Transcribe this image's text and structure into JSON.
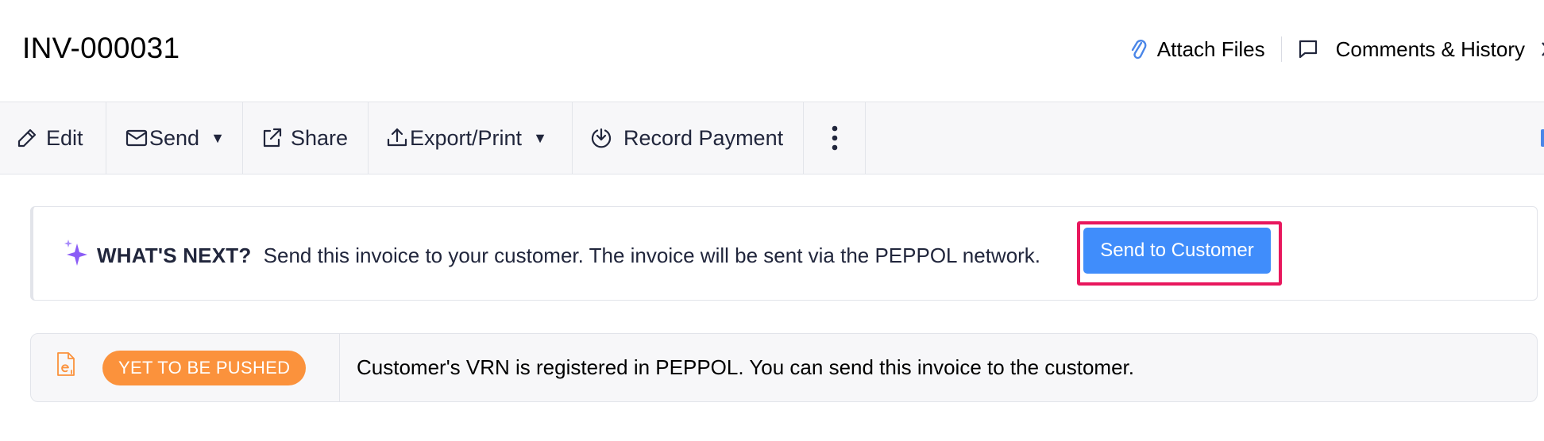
{
  "header": {
    "title": "INV-000031",
    "attach_label": "Attach Files",
    "comments_label": "Comments & History"
  },
  "toolbar": {
    "edit_label": "Edit",
    "send_label": "Send",
    "share_label": "Share",
    "export_label": "Export/Print",
    "record_payment_label": "Record Payment"
  },
  "whats_next": {
    "heading": "WHAT'S NEXT?",
    "message": "Send this invoice to your customer. The invoice will be sent via the PEPPOL network.",
    "button_label": "Send to Customer"
  },
  "peppol_status": {
    "badge": "YET TO BE PUSHED",
    "message": "Customer's VRN is registered in PEPPOL. You can send this invoice to the customer."
  },
  "icons": {
    "attach": "paperclip-icon",
    "comments": "comment-icon",
    "edit": "pencil-icon",
    "send": "mail-icon",
    "share": "share-icon",
    "export": "upload-icon",
    "record_payment": "download-circle-icon",
    "more": "more-vertical-icon",
    "whats_next": "sparkle-icon",
    "einvoice": "einvoice-document-icon"
  },
  "colors": {
    "primary_button": "#408dfb",
    "highlight_border": "#e8175d",
    "badge": "#fb923c",
    "attach_icon": "#4a86e8",
    "sparkle": "#8b5cf6",
    "einvoice_icon": "#fb923c"
  }
}
